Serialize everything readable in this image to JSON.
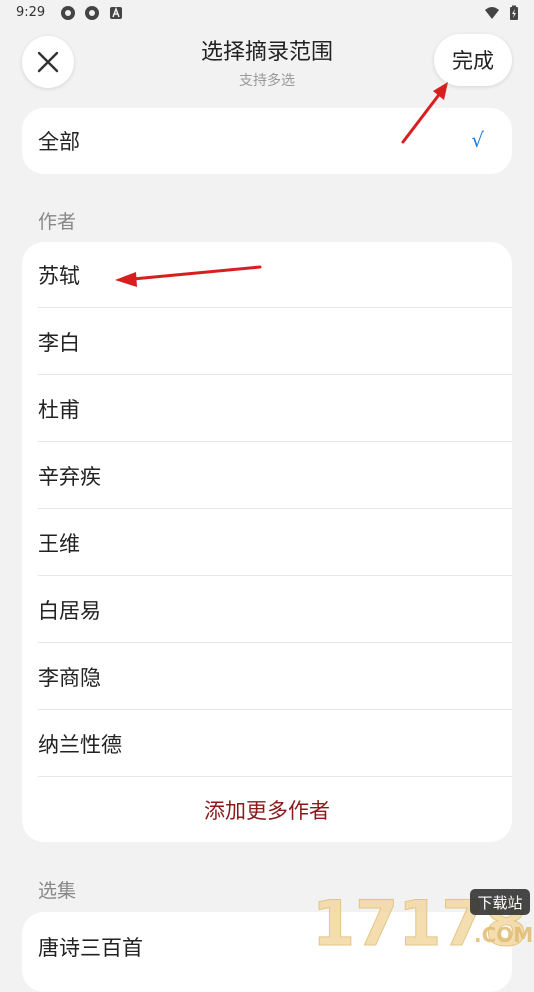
{
  "status_bar": {
    "time": "9:29"
  },
  "header": {
    "title": "选择摘录范围",
    "subtitle": "支持多选",
    "done_label": "完成"
  },
  "all_option": {
    "label": "全部",
    "check": "√",
    "selected": true
  },
  "authors_section": {
    "label": "作者",
    "items": [
      {
        "label": "苏轼"
      },
      {
        "label": "李白"
      },
      {
        "label": "杜甫"
      },
      {
        "label": "辛弃疾"
      },
      {
        "label": "王维"
      },
      {
        "label": "白居易"
      },
      {
        "label": "李商隐"
      },
      {
        "label": "纳兰性德"
      }
    ],
    "add_more_label": "添加更多作者"
  },
  "collections_section": {
    "label": "选集",
    "items": [
      {
        "label": "唐诗三百首"
      }
    ]
  },
  "watermark": {
    "text": "17178",
    "badge": "下载站",
    "suffix": ".COM"
  },
  "colors": {
    "accent_check": "#1f7fe0",
    "add_more": "#8b1a1a",
    "arrow": "#d81e1e"
  }
}
